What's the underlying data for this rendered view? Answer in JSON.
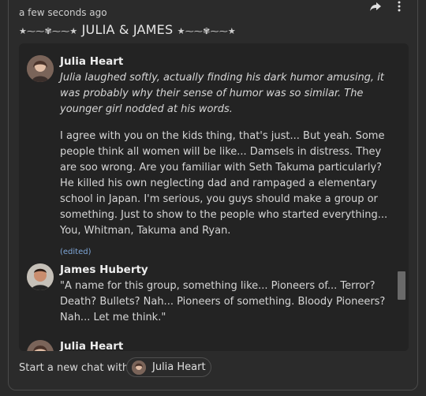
{
  "header": {
    "timestamp": "a few seconds ago",
    "title_ornament_left": "★⁓⁓✾⁓⁓★",
    "title": "JULIA & JAMES",
    "title_ornament_right": "★⁓⁓✾⁓⁓★",
    "icons": [
      "share-icon",
      "more-icon"
    ]
  },
  "messages": [
    {
      "name": "Julia Heart",
      "action": "Julia laughed softly, actually finding his dark humor amusing, it was probably why their sense of humor was so similar. The younger girl nodded at his words.",
      "text": "I agree with you on the kids thing, that's just... But yeah. Some people think all women will be like... Damsels in distress. They are soo wrong. Are you familiar with Seth Takuma particularly? He killed his own neglecting dad and rampaged a elementary school in Japan. I'm serious, you guys should make a group or something. Just to show to the people who started everything... You, Whitman, Takuma and Ryan.",
      "edited": "(edited)"
    },
    {
      "name": "James Huberty",
      "text": "\"A name for this group, something like... Pioneers of... Terror? Death? Bullets? Nah... Pioneers of something. Bloody Pioneers? Nah... Let me think.\""
    },
    {
      "name": "Julia Heart"
    }
  ],
  "footer": {
    "label": "Start a new chat with",
    "chip_label": "Julia Heart"
  },
  "colors": {
    "background": "#2a2a2a",
    "chat_box": "#232323",
    "edited": "#7fa7d8"
  }
}
